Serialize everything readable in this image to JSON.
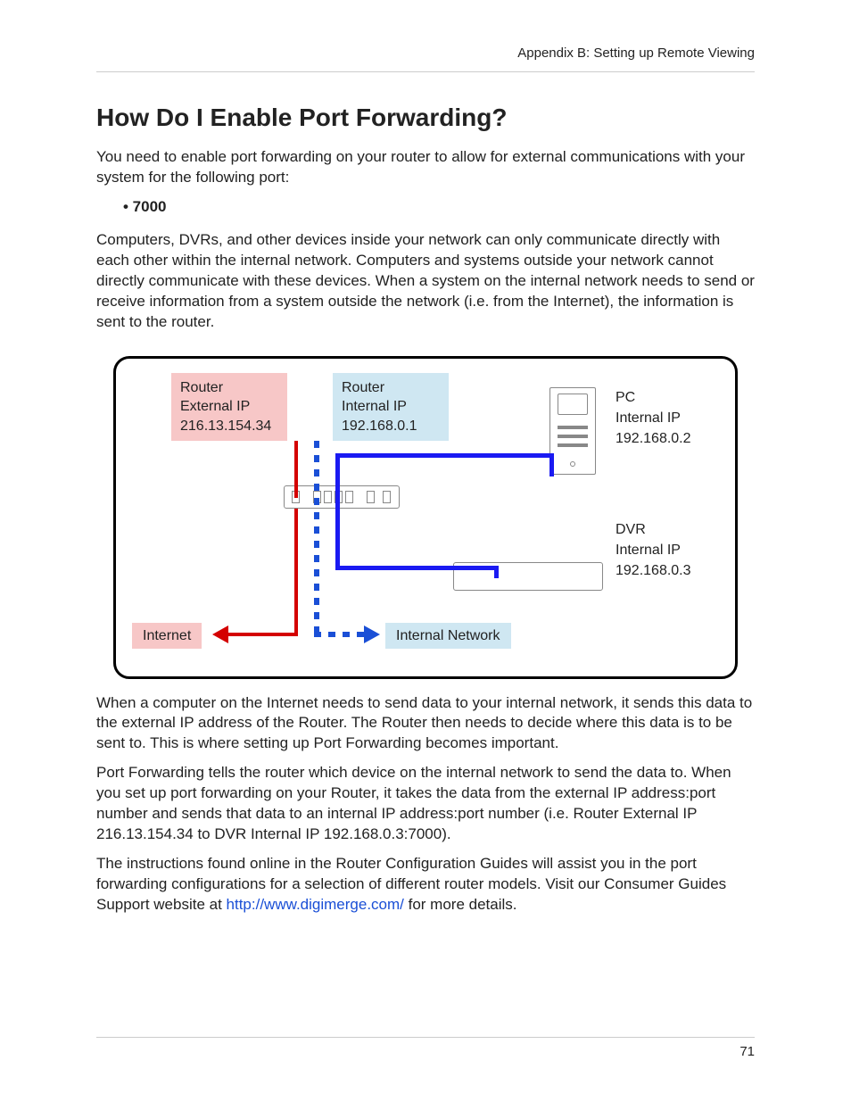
{
  "running_head": "Appendix B: Setting up Remote Viewing",
  "title": "How Do I Enable Port Forwarding?",
  "p1": "You need to enable port forwarding on your router to allow for external communications with your system for the following port:",
  "bullet": "• 7000",
  "p2": "Computers, DVRs, and other devices inside your network can only communicate directly with each other within the internal network. Computers and systems outside your network cannot directly communicate with these devices. When a system on the internal network needs to send or receive information from a system outside the network (i.e. from the Internet), the information is sent to the router.",
  "p3": "When a computer on the Internet needs to send data to your internal network, it sends this data to the external IP address of the Router. The Router then needs to decide where this data is to be sent to. This is where setting up Port Forwarding becomes important.",
  "p4": "Port Forwarding tells the router which device on the internal network to send the data to. When you set up port forwarding on your Router, it takes the data from the external IP address:port number and sends that data to an internal IP address:port number (i.e. Router External IP 216.13.154.34 to DVR Internal IP 192.168.0.3:7000).",
  "p5a": "The instructions found online in the Router Configuration Guides will assist you in the port forwarding configurations for a selection of different router models. Visit our Consumer Guides Support website at ",
  "p5link": "http://www.digimerge.com/",
  "p5b": " for more details.",
  "diagram": {
    "router_ext_l1": "Router",
    "router_ext_l2": "External IP",
    "router_ext_l3": "216.13.154.34",
    "router_int_l1": "Router",
    "router_int_l2": "Internal IP",
    "router_int_l3": "192.168.0.1",
    "pc_l1": "PC",
    "pc_l2": "Internal IP",
    "pc_l3": "192.168.0.2",
    "dvr_l1": "DVR",
    "dvr_l2": "Internal IP",
    "dvr_l3": "192.168.0.3",
    "internet": "Internet",
    "internal_net": "Internal Network"
  },
  "page_number": "71"
}
